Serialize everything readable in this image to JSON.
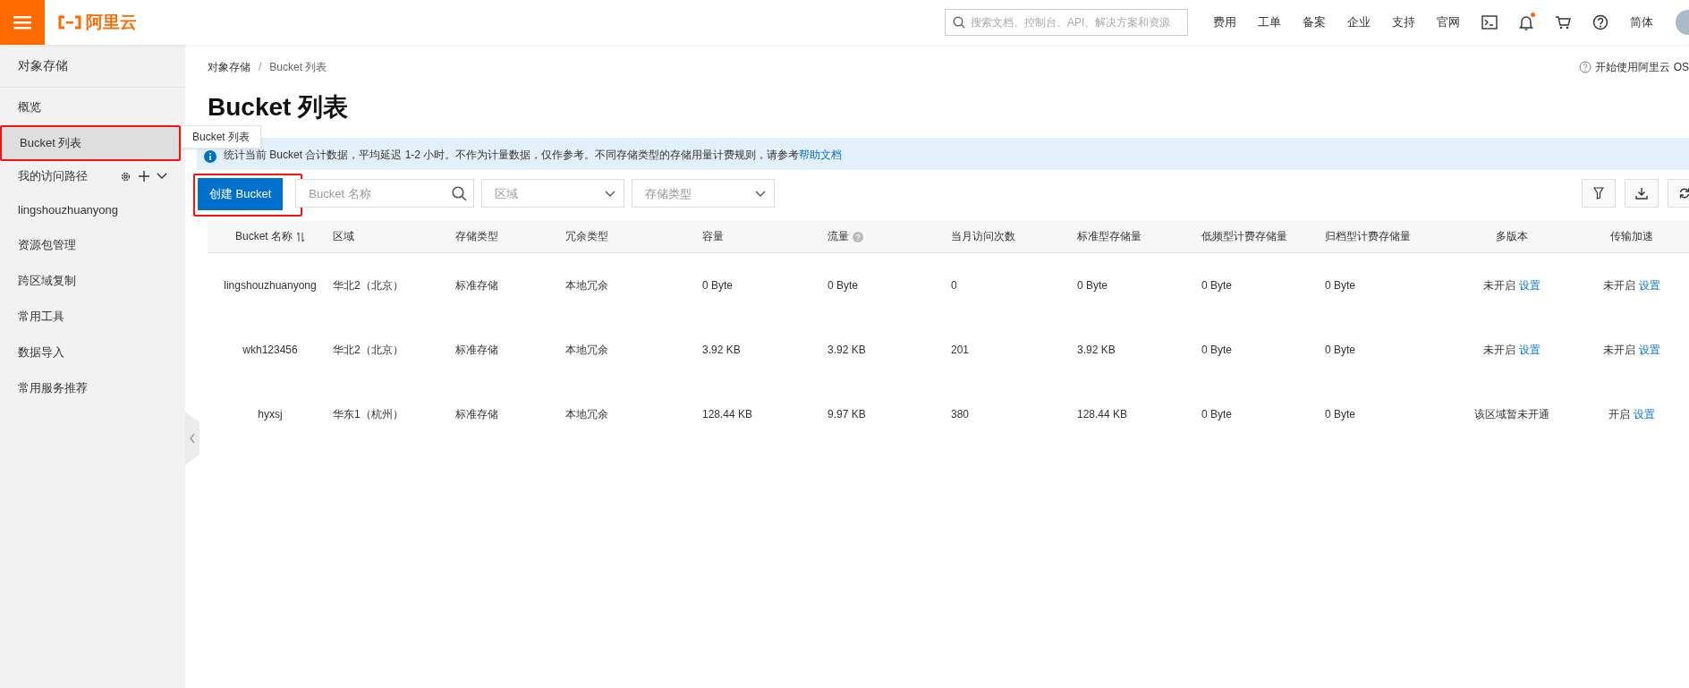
{
  "topbar": {
    "logo_text": "阿里云",
    "search": {
      "placeholder": "搜索文档、控制台、API、解决方案和资源"
    },
    "nav": [
      "费用",
      "工单",
      "备案",
      "企业",
      "支持",
      "官网"
    ],
    "notifications": {
      "unread": true
    },
    "language": "简体"
  },
  "sidebar": {
    "title": "对象存储",
    "items": [
      {
        "kind": "link",
        "label": "概览",
        "selected": false,
        "highlighted": false
      },
      {
        "kind": "link",
        "label": "Bucket 列表",
        "selected": true,
        "highlighted": true
      },
      {
        "kind": "group",
        "label": "我的访问路径",
        "expanded": true
      },
      {
        "kind": "link",
        "label": "lingshouzhuanyong",
        "selected": false,
        "highlighted": false
      },
      {
        "kind": "link",
        "label": "资源包管理",
        "selected": false,
        "highlighted": false
      },
      {
        "kind": "link",
        "label": "跨区域复制",
        "selected": false,
        "highlighted": false
      },
      {
        "kind": "link",
        "label": "常用工具",
        "selected": false,
        "highlighted": false
      },
      {
        "kind": "link",
        "label": "数据导入",
        "selected": false,
        "highlighted": false
      },
      {
        "kind": "link",
        "label": "常用服务推荐",
        "selected": false,
        "highlighted": false
      }
    ],
    "tooltip": "Bucket 列表"
  },
  "breadcrumb": {
    "items": [
      "对象存储",
      "Bucket 列表"
    ],
    "separator": "/"
  },
  "help_link": "开始使用阿里云 OS",
  "page_title": "Bucket 列表",
  "notice": {
    "text": "统计当前 Bucket 合计数据，平均延迟 1-2 小时。不作为计量数据，仅作参考。不同存储类型的存储用量计费规则，请参考",
    "link": "帮助文档"
  },
  "toolbar": {
    "create_button": {
      "label": "创建 Bucket",
      "highlighted": true
    },
    "search": {
      "placeholder": "Bucket 名称"
    },
    "filters": [
      {
        "placeholder": "区域"
      },
      {
        "placeholder": "存储类型"
      }
    ]
  },
  "table": {
    "columns": [
      {
        "label": "Bucket 名称",
        "sortable": true
      },
      {
        "label": "区域"
      },
      {
        "label": "存储类型"
      },
      {
        "label": "冗余类型"
      },
      {
        "label": "容量"
      },
      {
        "label": "流量",
        "help": true
      },
      {
        "label": "当月访问次数"
      },
      {
        "label": "标准型存储量"
      },
      {
        "label": "低频型计费存储量"
      },
      {
        "label": "归档型计费存储量"
      },
      {
        "label": "多版本"
      },
      {
        "label": "传输加速"
      }
    ],
    "rows": [
      {
        "cells": [
          "lingshouzhuanyong",
          "华北2（北京）",
          "标准存储",
          "本地冗余",
          "0 Byte",
          "0 Byte",
          "0",
          "0 Byte",
          "0 Byte",
          "0 Byte",
          {
            "status": "未开启",
            "link": "设置"
          },
          {
            "status": "未开启",
            "link": "设置"
          }
        ]
      },
      {
        "cells": [
          "wkh123456",
          "华北2（北京）",
          "标准存储",
          "本地冗余",
          "3.92 KB",
          "3.92 KB",
          "201",
          "3.92 KB",
          "0 Byte",
          "0 Byte",
          {
            "status": "未开启",
            "link": "设置"
          },
          {
            "status": "未开启",
            "link": "设置"
          }
        ]
      },
      {
        "cells": [
          "hyxsj",
          "华东1（杭州）",
          "标准存储",
          "本地冗余",
          "128.44 KB",
          "9.97 KB",
          "380",
          "128.44 KB",
          "0 Byte",
          "0 Byte",
          {
            "status": "该区域暂未开通"
          },
          {
            "status": "开启",
            "link": "设置"
          }
        ]
      }
    ]
  }
}
